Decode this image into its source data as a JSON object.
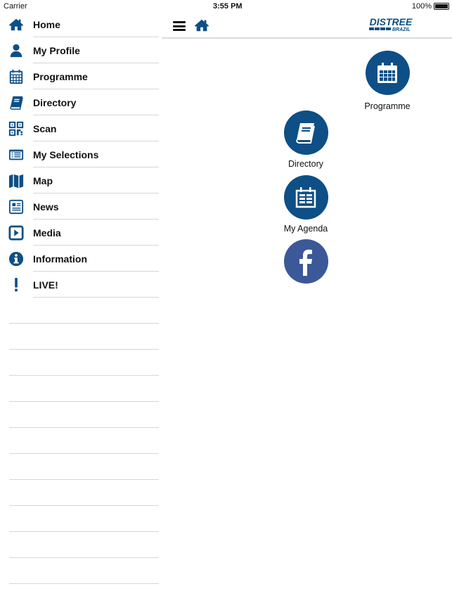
{
  "status": {
    "carrier": "Carrier",
    "time": "3:55 PM",
    "battery": "100%"
  },
  "sidebar": {
    "items": [
      {
        "label": "Home",
        "icon": "home-icon"
      },
      {
        "label": "My Profile",
        "icon": "user-icon"
      },
      {
        "label": "Programme",
        "icon": "calendar-icon"
      },
      {
        "label": "Directory",
        "icon": "book-icon"
      },
      {
        "label": "Scan",
        "icon": "qr-code-icon"
      },
      {
        "label": "My Selections",
        "icon": "list-icon"
      },
      {
        "label": "Map",
        "icon": "map-icon"
      },
      {
        "label": "News",
        "icon": "newspaper-icon"
      },
      {
        "label": "Media",
        "icon": "play-icon"
      },
      {
        "label": "Information",
        "icon": "info-icon"
      },
      {
        "label": "LIVE!",
        "icon": "exclamation-icon"
      }
    ]
  },
  "header": {
    "logo": "DISTREE BRAZIL"
  },
  "tiles": [
    {
      "label": "Programme",
      "icon": "calendar-icon"
    },
    {
      "label": "Directory",
      "icon": "book-icon"
    },
    {
      "label": "My Agenda",
      "icon": "agenda-icon"
    },
    {
      "label": "",
      "icon": "facebook-icon"
    }
  ],
  "colors": {
    "accent": "#0d4f86",
    "facebook": "#3b5998"
  }
}
